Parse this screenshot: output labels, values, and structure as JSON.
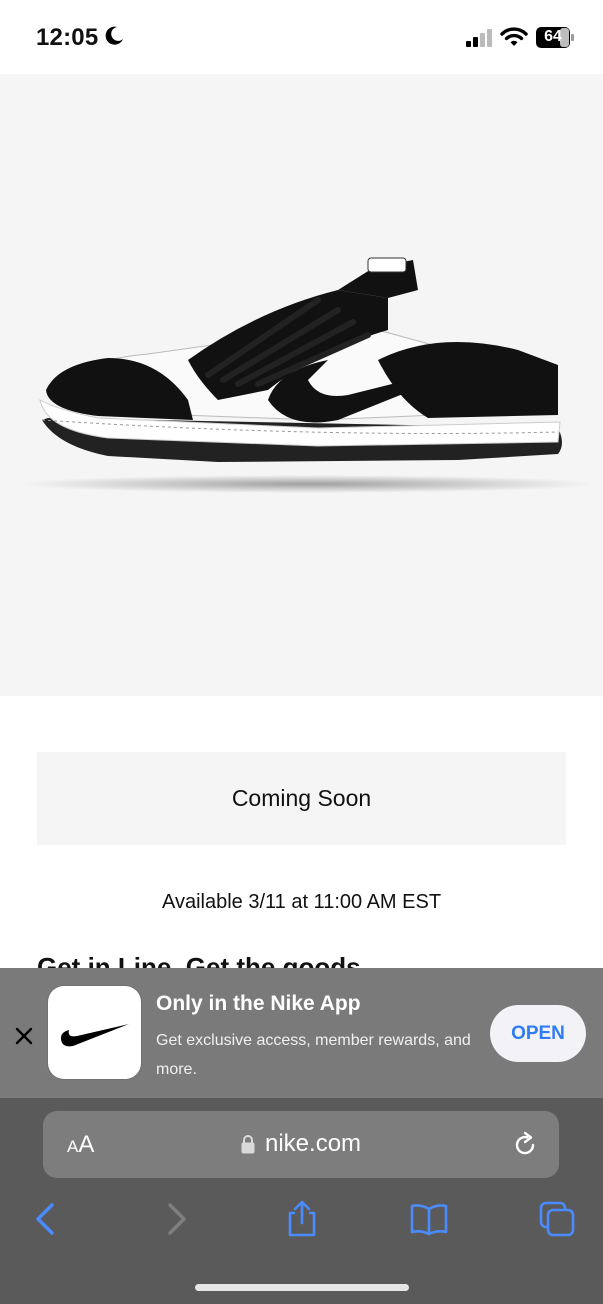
{
  "status_bar": {
    "time": "12:05",
    "battery": "64"
  },
  "product": {
    "image": "nike-dunk-low-black-white-shoe",
    "button_label": "Coming Soon",
    "availability": "Available 3/11 at 11:00 AM EST",
    "section_heading": "Get in Line. Get the goods."
  },
  "app_banner": {
    "title": "Only in the Nike App",
    "subtitle": "Get exclusive access, member rewards, and more.",
    "open_label": "OPEN",
    "icon": "nike-swoosh-icon"
  },
  "browser": {
    "text_size_small": "A",
    "text_size_big": "A",
    "url": "nike.com"
  },
  "colors": {
    "accent_blue": "#2f7cf6",
    "toolbar_bg": "#5a5a5a",
    "banner_bg": "#7a7a7a",
    "hero_bg": "#f5f5f5"
  }
}
